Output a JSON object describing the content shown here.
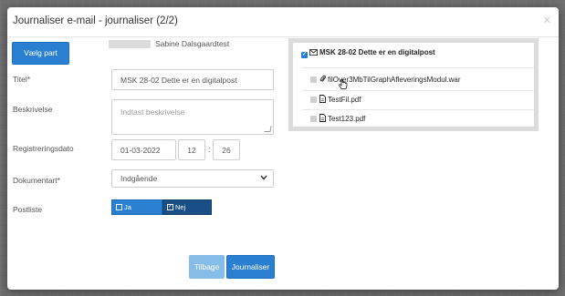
{
  "dialog": {
    "title": "Journaliser e-mail - journaliser (2/2)",
    "close_icon": "close-icon"
  },
  "party": {
    "button_label": "Vælg part",
    "name": "Sabine Dalsgaardtest"
  },
  "form": {
    "title_label": "Titel*",
    "title_value": "MSK 28-02 Dette er en digitalpost",
    "description_label": "Beskrivelse",
    "description_placeholder": "Indtast beskrivelse",
    "date_label": "Registreringsdato",
    "date_value": "01-03-2022",
    "hour_value": "12",
    "minute_value": "26",
    "time_separator": ":",
    "doctype_label": "Dokumentart*",
    "doctype_value": "Indgående",
    "postliste_label": "Postliste",
    "postliste_ja": "Ja",
    "postliste_nej": "Nej"
  },
  "buttons": {
    "back": "Tilbage",
    "submit": "Journaliser"
  },
  "tree": {
    "root_label": "MSK 28-02 Dette er en digitalpost",
    "items": [
      {
        "label": "filOver3MbTilGraphAfleveringsModul.war",
        "icon": "paperclip-icon"
      },
      {
        "label": "TestFil.pdf",
        "icon": "file-icon"
      },
      {
        "label": "Test123.pdf",
        "icon": "file-icon"
      }
    ]
  },
  "colors": {
    "primary": "#2a7fd0",
    "primary_light": "#85bde8",
    "toggle_selected": "#174f86",
    "overlay": "#6f6f6f"
  }
}
